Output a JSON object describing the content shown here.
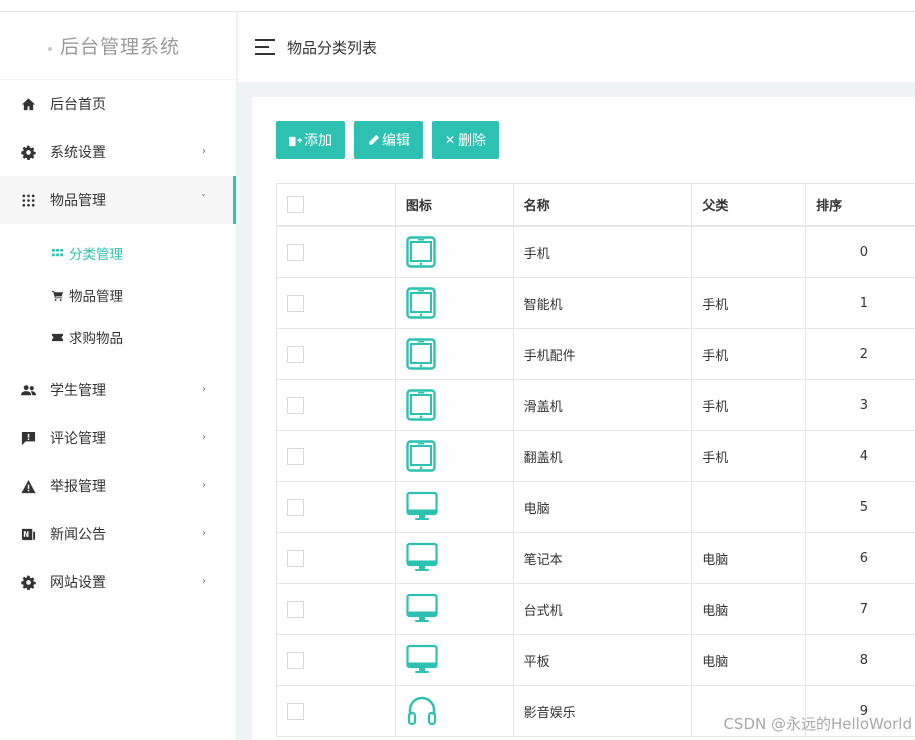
{
  "app": {
    "title": "后台管理系统"
  },
  "header": {
    "page_title": "物品分类列表"
  },
  "sidebar": {
    "items": [
      {
        "label": "后台首页",
        "icon": "home-icon"
      },
      {
        "label": "系统设置",
        "icon": "gear-icon"
      },
      {
        "label": "物品管理",
        "icon": "grid-icon"
      },
      {
        "label": "学生管理",
        "icon": "people-icon"
      },
      {
        "label": "评论管理",
        "icon": "comment-icon"
      },
      {
        "label": "举报管理",
        "icon": "warning-icon"
      },
      {
        "label": "新闻公告",
        "icon": "news-icon"
      },
      {
        "label": "网站设置",
        "icon": "gear-icon"
      }
    ],
    "sub_items": [
      {
        "label": "分类管理",
        "icon": "grid-small-icon"
      },
      {
        "label": "物品管理",
        "icon": "cart-icon"
      },
      {
        "label": "求购物品",
        "icon": "ticket-icon"
      }
    ]
  },
  "toolbar": {
    "add_label": "添加",
    "edit_label": "编辑",
    "delete_label": "删除"
  },
  "table": {
    "columns": [
      "图标",
      "名称",
      "父类",
      "排序"
    ],
    "rows": [
      {
        "icon": "tablet-icon",
        "name": "手机",
        "parent": "",
        "sort": "0"
      },
      {
        "icon": "tablet-icon",
        "name": "智能机",
        "parent": "手机",
        "sort": "1"
      },
      {
        "icon": "tablet-icon",
        "name": "手机配件",
        "parent": "手机",
        "sort": "2"
      },
      {
        "icon": "tablet-icon",
        "name": "滑盖机",
        "parent": "手机",
        "sort": "3"
      },
      {
        "icon": "tablet-icon",
        "name": "翻盖机",
        "parent": "手机",
        "sort": "4"
      },
      {
        "icon": "monitor-icon",
        "name": "电脑",
        "parent": "",
        "sort": "5"
      },
      {
        "icon": "monitor-icon",
        "name": "笔记本",
        "parent": "电脑",
        "sort": "6"
      },
      {
        "icon": "monitor-icon",
        "name": "台式机",
        "parent": "电脑",
        "sort": "7"
      },
      {
        "icon": "monitor-icon",
        "name": "平板",
        "parent": "电脑",
        "sort": "8"
      },
      {
        "icon": "headphones-icon",
        "name": "影音娱乐",
        "parent": "",
        "sort": "9"
      }
    ]
  },
  "watermark": "CSDN @永远的HelloWorld",
  "colors": {
    "accent": "#2cc1b0",
    "text": "#333333",
    "border": "#e6e6e6"
  }
}
